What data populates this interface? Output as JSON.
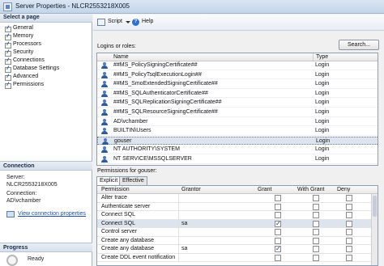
{
  "window": {
    "title": "Server Properties - NLCR2553218X005"
  },
  "left_panel": {
    "select_page_header": "Select a page",
    "pages": [
      {
        "label": "General"
      },
      {
        "label": "Memory"
      },
      {
        "label": "Processors"
      },
      {
        "label": "Security"
      },
      {
        "label": "Connections"
      },
      {
        "label": "Database Settings"
      },
      {
        "label": "Advanced"
      },
      {
        "label": "Permissions"
      }
    ],
    "connection_header": "Connection",
    "server_label": "Server:",
    "server_value": "NLCR2553218X005",
    "connection_label": "Connection:",
    "connection_value": "AD\\vchamber",
    "view_connection_link": "View connection properties",
    "progress_header": "Progress",
    "progress_status": "Ready"
  },
  "toolbar": {
    "script_label": "Script",
    "help_label": "Help"
  },
  "logins": {
    "label": "Logins or roles:",
    "search_label": "Search...",
    "columns": {
      "name": "Name",
      "type": "Type"
    },
    "rows": [
      {
        "name": "##MS_PolicySigningCertificate##",
        "type": "Login"
      },
      {
        "name": "##MS_PolicyTsqlExecutionLogin##",
        "type": "Login"
      },
      {
        "name": "##MS_SmoExtendedSigningCertificate##",
        "type": "Login"
      },
      {
        "name": "##MS_SQLAuthenticatorCertificate##",
        "type": "Login"
      },
      {
        "name": "##MS_SQLReplicationSigningCertificate##",
        "type": "Login"
      },
      {
        "name": "##MS_SQLResourceSigningCertificate##",
        "type": "Login"
      },
      {
        "name": "AD\\vchamber",
        "type": "Login"
      },
      {
        "name": "BUILTIN\\Users",
        "type": "Login"
      },
      {
        "name": "gouser",
        "type": "Login"
      },
      {
        "name": "NT AUTHORITY\\SYSTEM",
        "type": "Login"
      },
      {
        "name": "NT SERVICE\\MSSQLSERVER",
        "type": "Login"
      }
    ],
    "selected_index": 8
  },
  "permissions": {
    "label": "Permissions for gouser:",
    "tabs": [
      {
        "label": "Explicit"
      },
      {
        "label": "Effective"
      }
    ],
    "active_tab": 0,
    "columns": {
      "permission": "Permission",
      "grantor": "Grantor",
      "grant": "Grant",
      "with_grant": "With Grant",
      "deny": "Deny"
    },
    "rows": [
      {
        "permission": "Alter trace",
        "grantor": "",
        "grant": false,
        "with_grant": false,
        "deny": false
      },
      {
        "permission": "Authenticate server",
        "grantor": "",
        "grant": false,
        "with_grant": false,
        "deny": false
      },
      {
        "permission": "Connect SQL",
        "grantor": "",
        "grant": false,
        "with_grant": false,
        "deny": false
      },
      {
        "permission": "Connect SQL",
        "grantor": "sa",
        "grant": true,
        "with_grant": false,
        "deny": false
      },
      {
        "permission": "Control server",
        "grantor": "",
        "grant": false,
        "with_grant": false,
        "deny": false
      },
      {
        "permission": "Create any database",
        "grantor": "",
        "grant": false,
        "with_grant": false,
        "deny": false
      },
      {
        "permission": "Create any database",
        "grantor": "sa",
        "grant": true,
        "with_grant": false,
        "deny": false
      },
      {
        "permission": "Create DDL event notification",
        "grantor": "",
        "grant": false,
        "with_grant": false,
        "deny": false
      }
    ],
    "selected_index": 3
  }
}
